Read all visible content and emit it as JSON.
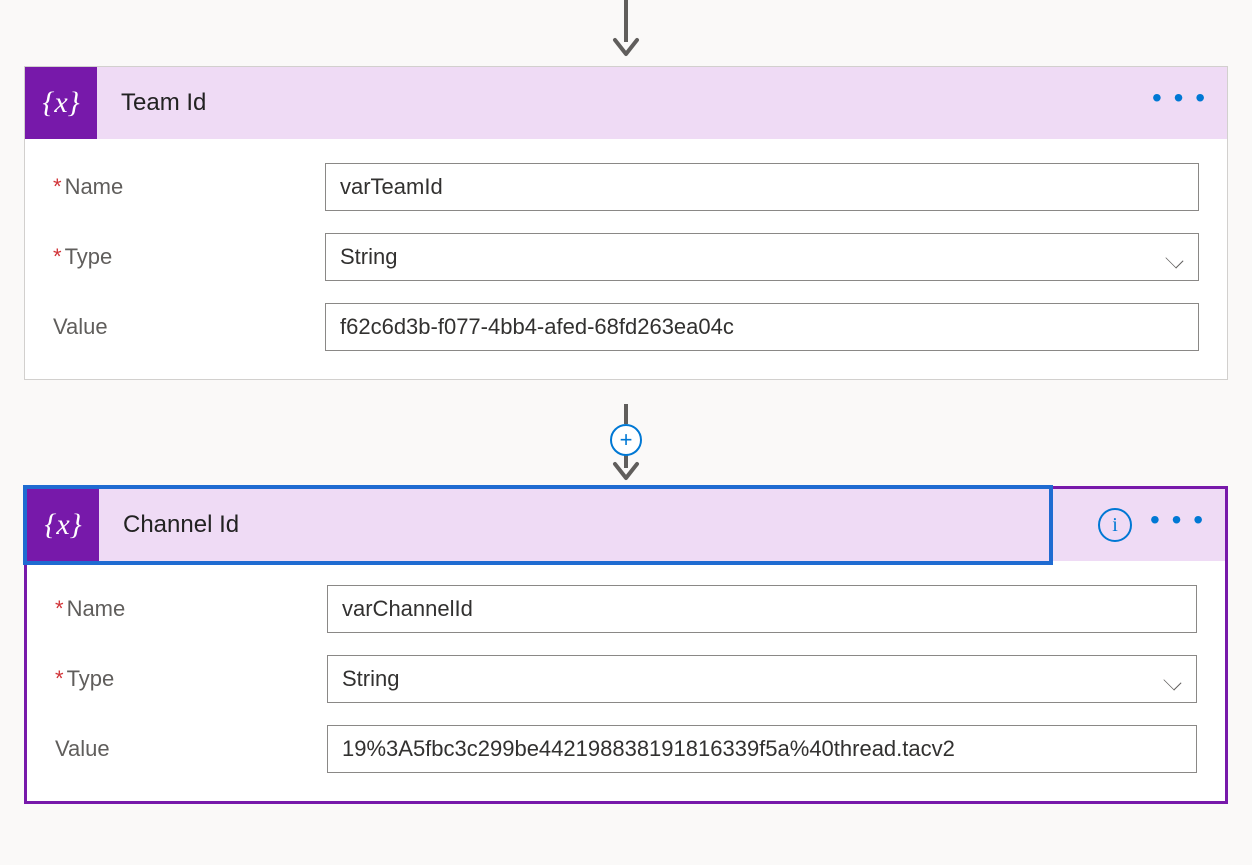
{
  "connector": {
    "add_label": "+"
  },
  "icons": {
    "variable": "{x}",
    "info": "i",
    "ellipsis": "• • •"
  },
  "labels": {
    "name": "Name",
    "type": "Type",
    "value": "Value"
  },
  "cards": [
    {
      "title": "Team Id",
      "fields": {
        "name": "varTeamId",
        "type": "String",
        "value": "f62c6d3b-f077-4bb4-afed-68fd263ea04c"
      },
      "has_info": false
    },
    {
      "title": "Channel Id",
      "fields": {
        "name": "varChannelId",
        "type": "String",
        "value": "19%3A5fbc3c299be442198838191816339f5a%40thread.tacv2"
      },
      "has_info": true
    }
  ]
}
